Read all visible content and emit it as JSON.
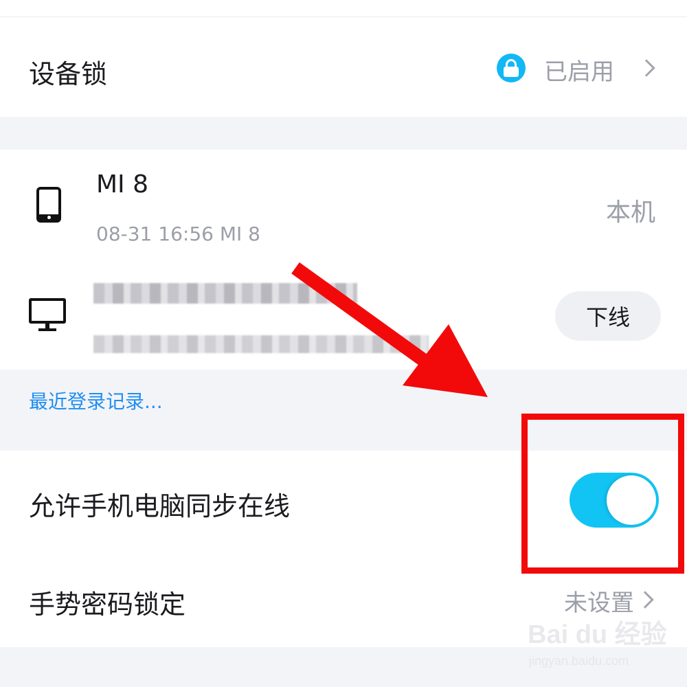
{
  "device_lock": {
    "title": "设备锁",
    "status": "已启用",
    "status_icon": "lock-icon",
    "accent": "#12b7f5"
  },
  "devices": [
    {
      "name": "MI 8",
      "detail": "08-31 16:56 MI 8",
      "tag": "本机",
      "icon": "phone-icon"
    },
    {
      "name": "",
      "detail": "",
      "action": "下线",
      "icon": "desktop-icon",
      "pixelated": true
    }
  ],
  "recent_login_link": "最近登录记录...",
  "sync_online": {
    "label": "允许手机电脑同步在线",
    "enabled": true,
    "toggle_color": "#12c4f4"
  },
  "gesture_lock": {
    "label": "手势密码锁定",
    "status": "未设置"
  },
  "annotation": {
    "arrow_color": "#f20a0a",
    "highlight": "sync-toggle"
  },
  "watermark": {
    "logo": "Bai du 经验",
    "url": "jingyan.baidu.com"
  }
}
